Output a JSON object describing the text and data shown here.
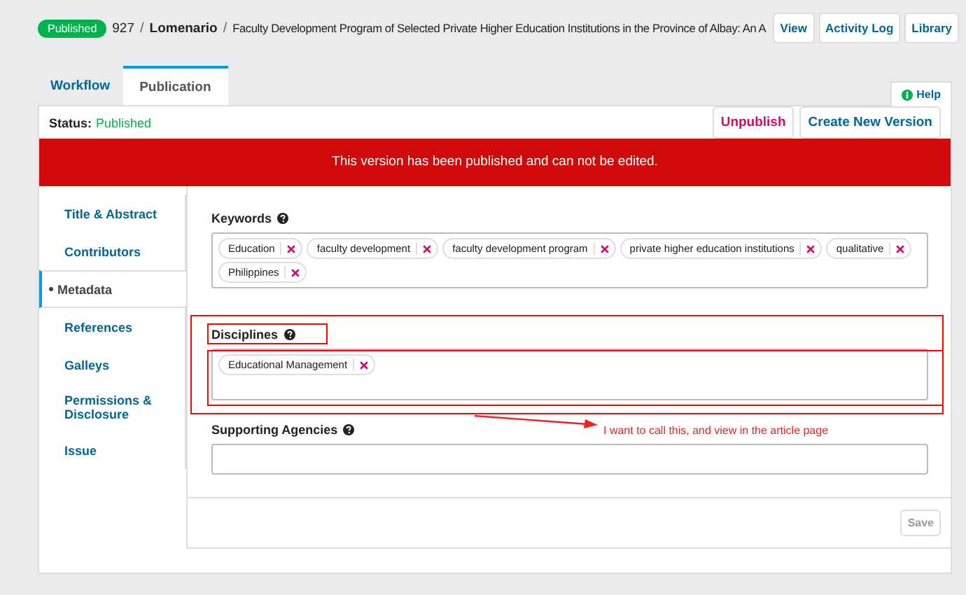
{
  "header": {
    "badge": "Published",
    "id": "927",
    "author": "Lomenario",
    "separators": [
      "/",
      "/"
    ],
    "title": "Faculty Development Program of Selected Private Higher Education Institutions in the Province of Albay: An A",
    "buttons": [
      "View",
      "Activity Log",
      "Library"
    ]
  },
  "tabs": [
    {
      "label": "Workflow",
      "selected": false
    },
    {
      "label": "Publication",
      "selected": true
    }
  ],
  "help": "Help",
  "status": {
    "label": "Status:",
    "value": "Published"
  },
  "actions": [
    {
      "label": "Unpublish",
      "kind": "danger"
    },
    {
      "label": "Create New Version",
      "kind": "primary"
    }
  ],
  "banner": "This version has been published and can not be edited.",
  "sidebar": [
    {
      "label": "Title & Abstract",
      "selected": false
    },
    {
      "label": "Contributors",
      "selected": false
    },
    {
      "label": "Metadata",
      "selected": true
    },
    {
      "label": "References",
      "selected": false
    },
    {
      "label": "Galleys",
      "selected": false
    },
    {
      "label": "Permissions & Disclosure",
      "selected": false
    },
    {
      "label": "Issue",
      "selected": false
    }
  ],
  "fields": [
    {
      "label": "Keywords",
      "tags": [
        "Education",
        "faculty development",
        "faculty development program",
        "private higher education institutions",
        "qualitative",
        "Philippines"
      ]
    },
    {
      "label": "Disciplines",
      "tags": [
        "Educational Management"
      ]
    },
    {
      "label": "Supporting Agencies"
    }
  ],
  "save": "Save",
  "annotation": "I want to call this, and view in the article page"
}
